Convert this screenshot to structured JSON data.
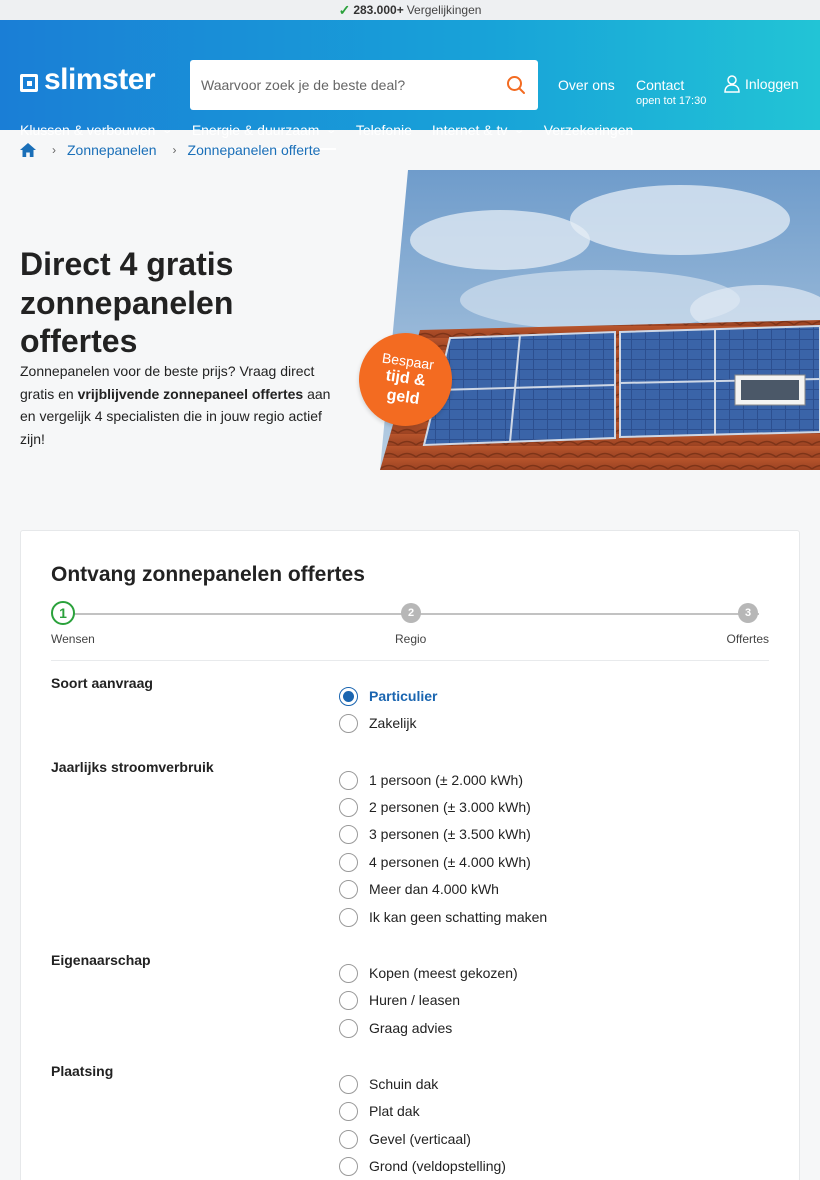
{
  "topbar": {
    "count": "283.000+",
    "text": "Vergelijkingen"
  },
  "header": {
    "logo": "slimster",
    "search_placeholder": "Waarvoor zoek je de beste deal?",
    "over_ons": "Over ons",
    "contact": "Contact",
    "contact_sub": "open tot 17:30",
    "login": "Inloggen"
  },
  "nav": [
    {
      "label": "Klussen & verbouwen",
      "dropdown": true
    },
    {
      "label": "Energie & duurzaam",
      "dropdown": true,
      "active": true
    },
    {
      "label": "Telefonie",
      "dropdown": false
    },
    {
      "label": "Internet & tv",
      "dropdown": true
    },
    {
      "label": "Verzekeringen",
      "dropdown": false
    }
  ],
  "breadcrumb": [
    "Zonnepanelen",
    "Zonnepanelen offerte"
  ],
  "hero": {
    "title": "Direct 4 gratis zonnepanelen offertes",
    "text_before": "Zonnepanelen voor de beste prijs? Vraag direct gratis en ",
    "text_bold": "vrijblijvende zonnepaneel offertes",
    "text_after": " aan en vergelijk 4 specialisten die in jouw regio actief zijn!",
    "badge_line1": "Bespaar",
    "badge_line2": "tijd &",
    "badge_line3": "geld"
  },
  "form": {
    "title": "Ontvang zonnepanelen offertes",
    "steps": [
      {
        "num": "1",
        "label": "Wensen",
        "active": true
      },
      {
        "num": "2",
        "label": "Regio",
        "active": false
      },
      {
        "num": "3",
        "label": "Offertes",
        "active": false
      }
    ],
    "questions": [
      {
        "label": "Soort aanvraag",
        "options": [
          "Particulier",
          "Zakelijk"
        ],
        "selected": "Particulier"
      },
      {
        "label": "Jaarlijks stroomverbruik",
        "options": [
          "1 persoon (± 2.000 kWh)",
          "2 personen (± 3.000 kWh)",
          "3 personen (± 3.500 kWh)",
          "4 personen (± 4.000 kWh)",
          "Meer dan 4.000 kWh",
          "Ik kan geen schatting maken"
        ],
        "selected": null
      },
      {
        "label": "Eigenaarschap",
        "options": [
          "Kopen (meest gekozen)",
          "Huren / leasen",
          "Graag advies"
        ],
        "selected": null
      },
      {
        "label": "Plaatsing",
        "options": [
          "Schuin dak",
          "Plat dak",
          "Gevel (verticaal)",
          "Grond (veldopstelling)"
        ],
        "selected": null
      }
    ]
  },
  "colors": {
    "brand_blue": "#1a7ed6",
    "accent_orange": "#f36b21",
    "step_green": "#2aa13b",
    "radio_blue": "#1a65b0"
  }
}
